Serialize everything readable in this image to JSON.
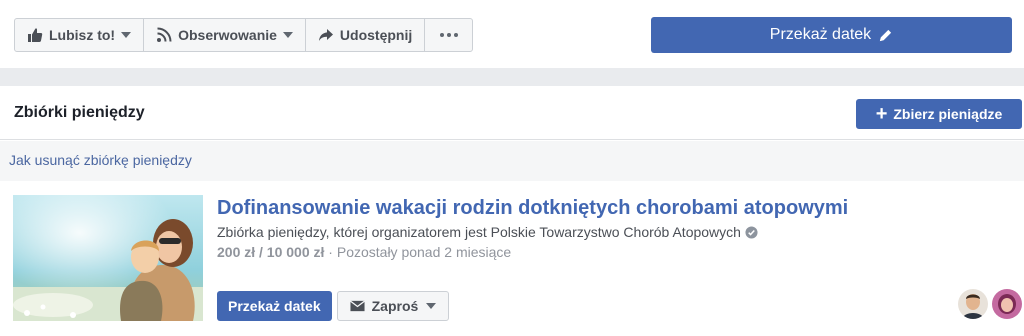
{
  "toolbar": {
    "like_label": "Lubisz to!",
    "follow_label": "Obserwowanie",
    "share_label": "Udostępnij",
    "donate_label": "Przekaż datek"
  },
  "fundraisers": {
    "title": "Zbiórki pieniędzy",
    "raise_button": "Zbierz pieniądze",
    "help_link": "Jak usunąć zbiórkę pieniędzy",
    "item": {
      "title": "Dofinansowanie wakacji rodzin dotkniętych chorobami atopowymi",
      "subtitle": "Zbiórka pieniędzy, której organizatorem jest Polskie Towarzystwo Chorób Atopowych",
      "amount": "200 zł / 10 000 zł",
      "separator": " · ",
      "remaining": "Pozostały ponad 2 miesiące",
      "donate_button": "Przekaż datek",
      "invite_button": "Zaproś"
    }
  },
  "icons": {
    "like": "thumbs-up-icon",
    "follow": "rss-icon",
    "share": "share-arrow-icon",
    "more": "ellipsis-icon",
    "edit": "pencil-icon",
    "add": "plus-icon",
    "verified": "verified-badge-icon",
    "invite": "envelope-icon"
  },
  "colors": {
    "brand": "#4267b2",
    "link": "#4b67a1",
    "page_bg": "#e9ebee",
    "muted_text": "#90949c"
  }
}
